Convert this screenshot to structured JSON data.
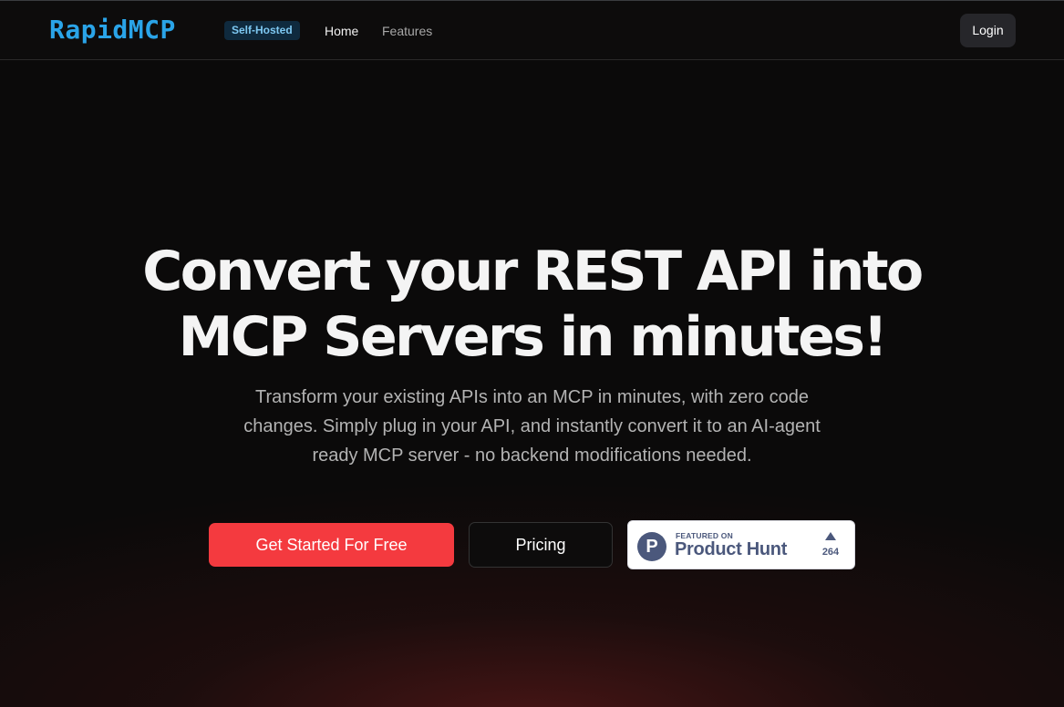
{
  "nav": {
    "logo": "RapidMCP",
    "badge": "Self-Hosted",
    "links": [
      "Home",
      "Features"
    ],
    "login_label": "Login"
  },
  "hero": {
    "title_line1": "Convert your REST API into",
    "title_line2": "MCP Servers in minutes!",
    "subtitle": "Transform your existing APIs into an MCP in minutes, with zero code changes. Simply plug in your API, and instantly convert it to an AI-agent ready MCP server - no backend modifications needed."
  },
  "actions": {
    "primary_label": "Get Started For Free",
    "secondary_label": "Pricing"
  },
  "product_hunt": {
    "logo_letter": "P",
    "featured_text": "FEATURED ON",
    "name": "Product Hunt",
    "upvotes": "264"
  },
  "colors": {
    "brand": "#2aa4e8",
    "primary_button": "#f43a3f",
    "background": "#0b0a0a",
    "product_hunt": "#4b587c"
  },
  "icons": {
    "product_hunt_logo": "product-hunt-logo-icon",
    "upvote": "triangle-up-icon"
  }
}
